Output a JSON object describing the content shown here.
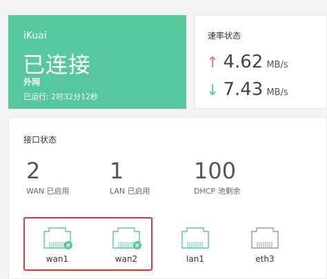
{
  "status": {
    "brand": "iKuai",
    "state": "已连接",
    "network": "外网",
    "uptime": "已运行: 2时32分12秒"
  },
  "speed": {
    "title": "速率状态",
    "up_arrow": "↑",
    "up_value": "4.62",
    "up_unit": "MB/s",
    "down_arrow": "↓",
    "down_value": "7.43",
    "down_unit": "MB/s",
    "colors": {
      "up": "#e57373",
      "down": "#56c89b"
    }
  },
  "interfaces": {
    "title": "接口状态",
    "stats": [
      {
        "value": "2",
        "label": "WAN 已启用"
      },
      {
        "value": "1",
        "label": "LAN 已启用"
      },
      {
        "value": "100",
        "label": "DHCP 池剩余"
      }
    ],
    "ports": [
      {
        "name": "wan1",
        "icon": "ethernet-port-linked-icon",
        "state": "connected-wan"
      },
      {
        "name": "wan2",
        "icon": "ethernet-port-linked-icon",
        "state": "connected-wan"
      },
      {
        "name": "lan1",
        "icon": "ethernet-port-icon",
        "state": "connected"
      },
      {
        "name": "eth3",
        "icon": "ethernet-port-icon",
        "state": "disconnected"
      }
    ]
  },
  "colors": {
    "accent": "#56c89b",
    "port_active": "#56c89b",
    "port_inactive": "#9a9a9a",
    "highlight": "#e03a2f"
  }
}
